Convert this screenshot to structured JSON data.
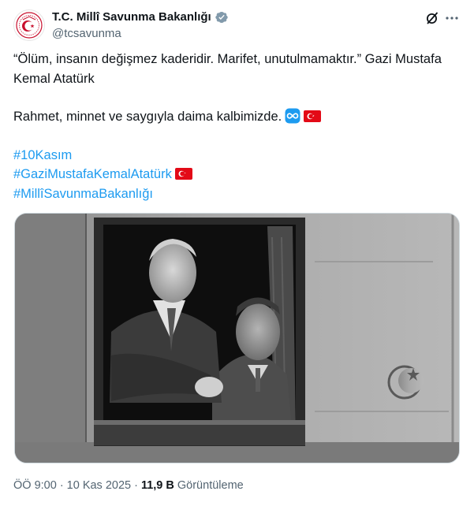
{
  "author": {
    "display_name": "T.C. Millî Savunma Bakanlığı",
    "handle": "@tcsavunma",
    "verified_color": "#829aab",
    "avatar_icon": "turkish-armed-forces-emblem-icon"
  },
  "actions": {
    "grok_icon": "grok-icon",
    "more_icon": "more-icon"
  },
  "tweet": {
    "line1": "“Ölüm, insanın değişmez kaderidir. Marifet, unutulmamaktır.” Gazi Mustafa Kemal Atatürk",
    "line2": "Rahmet, minnet ve saygıyla daima kalbimizde.",
    "hashtags": [
      "#10Kasım",
      "#GaziMustafaKemalAtatürk",
      "#MillîSavunmaBakanlığı"
    ],
    "emoji_after_line2": [
      "infinity-emoji",
      "turkey-flag-emoji"
    ],
    "emoji_after_hashtag2": "turkey-flag-emoji"
  },
  "media": {
    "type": "black-and-white photo",
    "subject": "two men looking out of a train window"
  },
  "meta": {
    "time": "ÖÖ 9:00",
    "date": "10 Kas 2025",
    "views_count": "11,9 B",
    "views_label": "Görüntüleme",
    "separator": "·"
  },
  "colors": {
    "text": "#0f1419",
    "secondary": "#536471",
    "link": "#1d9bf0",
    "border": "#cfd9de",
    "flag_red": "#e30a17"
  }
}
